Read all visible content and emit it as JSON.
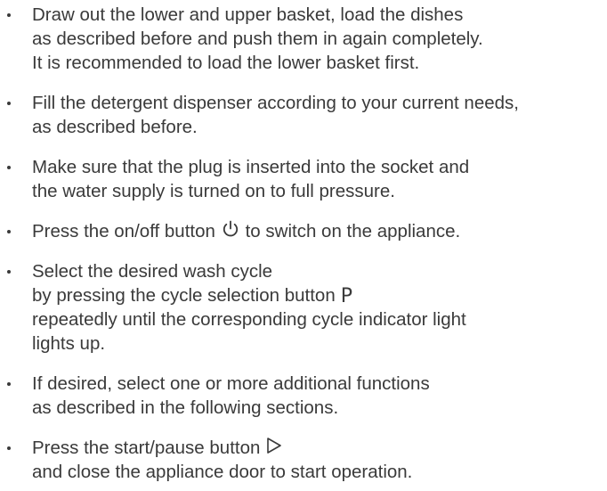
{
  "steps": [
    {
      "lines": [
        "Draw out the lower and upper basket, load the dishes",
        "as described before and push them in again completely.",
        "It is recommended to load the lower basket first."
      ]
    },
    {
      "lines": [
        "Fill the detergent dispenser according to your current needs,",
        "as described before."
      ]
    },
    {
      "lines": [
        "Make sure that the plug is inserted into the socket and",
        "the water supply is turned on to full pressure."
      ]
    },
    {
      "lines": [
        "Press the on/off button",
        "to switch on the appliance."
      ],
      "icon": "power-icon"
    },
    {
      "lines": [
        "Select the desired wash cycle",
        "by pressing the cycle selection button",
        "repeatedly until the corresponding cycle indicator light",
        "lights up."
      ],
      "symbol": "P"
    },
    {
      "lines": [
        "If desired, select one or more additional functions",
        "as described in the following sections."
      ]
    },
    {
      "lines": [
        "Press the start/pause button",
        "and close the appliance door to start operation."
      ],
      "icon": "play-outline-icon"
    }
  ]
}
